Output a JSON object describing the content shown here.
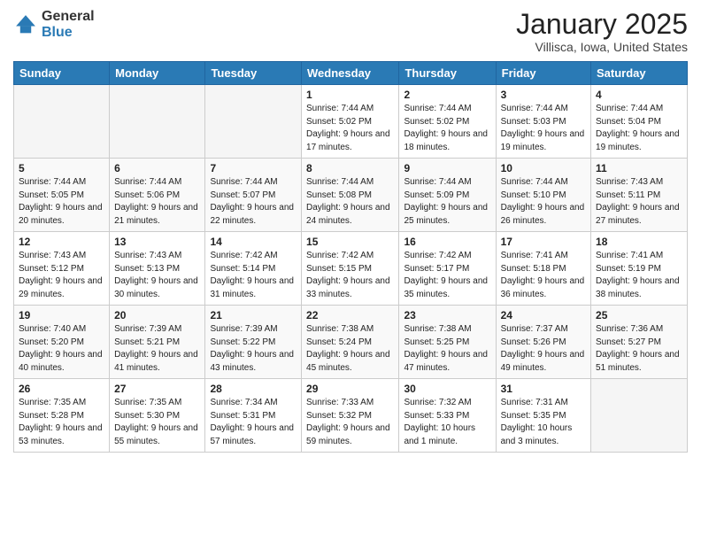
{
  "logo": {
    "general": "General",
    "blue": "Blue"
  },
  "header": {
    "month": "January 2025",
    "location": "Villisca, Iowa, United States"
  },
  "days_of_week": [
    "Sunday",
    "Monday",
    "Tuesday",
    "Wednesday",
    "Thursday",
    "Friday",
    "Saturday"
  ],
  "weeks": [
    [
      {
        "day": "",
        "empty": true
      },
      {
        "day": "",
        "empty": true
      },
      {
        "day": "",
        "empty": true
      },
      {
        "day": "1",
        "sunrise": "7:44 AM",
        "sunset": "5:02 PM",
        "daylight": "9 hours and 17 minutes."
      },
      {
        "day": "2",
        "sunrise": "7:44 AM",
        "sunset": "5:02 PM",
        "daylight": "9 hours and 18 minutes."
      },
      {
        "day": "3",
        "sunrise": "7:44 AM",
        "sunset": "5:03 PM",
        "daylight": "9 hours and 19 minutes."
      },
      {
        "day": "4",
        "sunrise": "7:44 AM",
        "sunset": "5:04 PM",
        "daylight": "9 hours and 19 minutes."
      }
    ],
    [
      {
        "day": "5",
        "sunrise": "7:44 AM",
        "sunset": "5:05 PM",
        "daylight": "9 hours and 20 minutes."
      },
      {
        "day": "6",
        "sunrise": "7:44 AM",
        "sunset": "5:06 PM",
        "daylight": "9 hours and 21 minutes."
      },
      {
        "day": "7",
        "sunrise": "7:44 AM",
        "sunset": "5:07 PM",
        "daylight": "9 hours and 22 minutes."
      },
      {
        "day": "8",
        "sunrise": "7:44 AM",
        "sunset": "5:08 PM",
        "daylight": "9 hours and 24 minutes."
      },
      {
        "day": "9",
        "sunrise": "7:44 AM",
        "sunset": "5:09 PM",
        "daylight": "9 hours and 25 minutes."
      },
      {
        "day": "10",
        "sunrise": "7:44 AM",
        "sunset": "5:10 PM",
        "daylight": "9 hours and 26 minutes."
      },
      {
        "day": "11",
        "sunrise": "7:43 AM",
        "sunset": "5:11 PM",
        "daylight": "9 hours and 27 minutes."
      }
    ],
    [
      {
        "day": "12",
        "sunrise": "7:43 AM",
        "sunset": "5:12 PM",
        "daylight": "9 hours and 29 minutes."
      },
      {
        "day": "13",
        "sunrise": "7:43 AM",
        "sunset": "5:13 PM",
        "daylight": "9 hours and 30 minutes."
      },
      {
        "day": "14",
        "sunrise": "7:42 AM",
        "sunset": "5:14 PM",
        "daylight": "9 hours and 31 minutes."
      },
      {
        "day": "15",
        "sunrise": "7:42 AM",
        "sunset": "5:15 PM",
        "daylight": "9 hours and 33 minutes."
      },
      {
        "day": "16",
        "sunrise": "7:42 AM",
        "sunset": "5:17 PM",
        "daylight": "9 hours and 35 minutes."
      },
      {
        "day": "17",
        "sunrise": "7:41 AM",
        "sunset": "5:18 PM",
        "daylight": "9 hours and 36 minutes."
      },
      {
        "day": "18",
        "sunrise": "7:41 AM",
        "sunset": "5:19 PM",
        "daylight": "9 hours and 38 minutes."
      }
    ],
    [
      {
        "day": "19",
        "sunrise": "7:40 AM",
        "sunset": "5:20 PM",
        "daylight": "9 hours and 40 minutes."
      },
      {
        "day": "20",
        "sunrise": "7:39 AM",
        "sunset": "5:21 PM",
        "daylight": "9 hours and 41 minutes."
      },
      {
        "day": "21",
        "sunrise": "7:39 AM",
        "sunset": "5:22 PM",
        "daylight": "9 hours and 43 minutes."
      },
      {
        "day": "22",
        "sunrise": "7:38 AM",
        "sunset": "5:24 PM",
        "daylight": "9 hours and 45 minutes."
      },
      {
        "day": "23",
        "sunrise": "7:38 AM",
        "sunset": "5:25 PM",
        "daylight": "9 hours and 47 minutes."
      },
      {
        "day": "24",
        "sunrise": "7:37 AM",
        "sunset": "5:26 PM",
        "daylight": "9 hours and 49 minutes."
      },
      {
        "day": "25",
        "sunrise": "7:36 AM",
        "sunset": "5:27 PM",
        "daylight": "9 hours and 51 minutes."
      }
    ],
    [
      {
        "day": "26",
        "sunrise": "7:35 AM",
        "sunset": "5:28 PM",
        "daylight": "9 hours and 53 minutes."
      },
      {
        "day": "27",
        "sunrise": "7:35 AM",
        "sunset": "5:30 PM",
        "daylight": "9 hours and 55 minutes."
      },
      {
        "day": "28",
        "sunrise": "7:34 AM",
        "sunset": "5:31 PM",
        "daylight": "9 hours and 57 minutes."
      },
      {
        "day": "29",
        "sunrise": "7:33 AM",
        "sunset": "5:32 PM",
        "daylight": "9 hours and 59 minutes."
      },
      {
        "day": "30",
        "sunrise": "7:32 AM",
        "sunset": "5:33 PM",
        "daylight": "10 hours and 1 minute."
      },
      {
        "day": "31",
        "sunrise": "7:31 AM",
        "sunset": "5:35 PM",
        "daylight": "10 hours and 3 minutes."
      },
      {
        "day": "",
        "empty": true
      }
    ]
  ]
}
